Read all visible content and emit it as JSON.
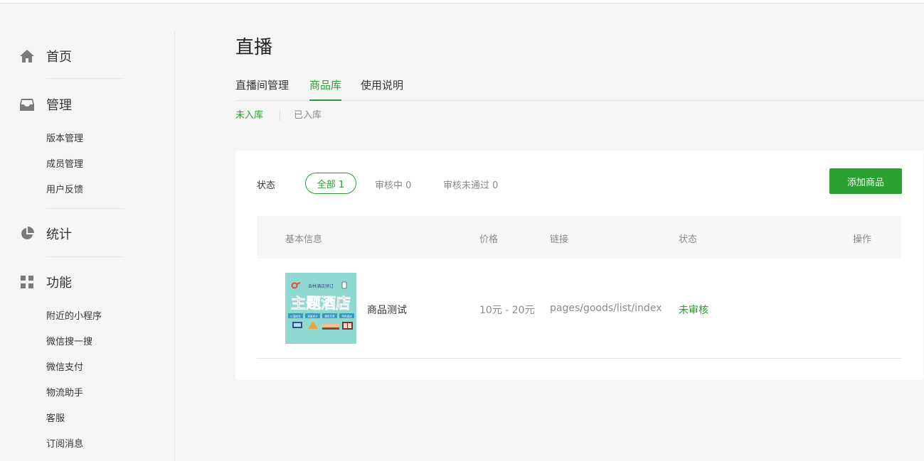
{
  "sidebar": {
    "home": {
      "label": "首页",
      "icon": "home-icon"
    },
    "manage": {
      "label": "管理",
      "icon": "inbox-icon",
      "items": [
        "版本管理",
        "成员管理",
        "用户反馈"
      ]
    },
    "stats": {
      "label": "统计",
      "icon": "pie-chart-icon"
    },
    "features": {
      "label": "功能",
      "icon": "grid-icon",
      "items": [
        "附近的小程序",
        "微信搜一搜",
        "微信支付",
        "物流助手",
        "客服",
        "订阅消息"
      ]
    }
  },
  "main": {
    "title": "直播",
    "tabs": [
      {
        "label": "直播间管理",
        "active": false
      },
      {
        "label": "商品库",
        "active": true
      },
      {
        "label": "使用说明",
        "active": false
      }
    ],
    "subtabs": [
      {
        "label": "未入库",
        "active": true
      },
      {
        "label": "已入库",
        "active": false
      }
    ],
    "filter": {
      "label": "状态",
      "options": [
        "全部 1",
        "审核中 0",
        "审核未通过 0"
      ],
      "selected": "全部 1"
    },
    "add_button": "添加商品",
    "table": {
      "headers": [
        "基本信息",
        "价格",
        "链接",
        "状态",
        "操作"
      ],
      "rows": [
        {
          "thumbnail": {
            "top_text": "去林酒店预订",
            "title": "主题酒店",
            "badges": [
              "IC酒店仓",
              "家庭亲子",
              "情侣专享",
              "特色酒店"
            ]
          },
          "name": "商品测试",
          "price": "10元 - 20元",
          "link": "pages/goods/list/index",
          "status": "未审核"
        }
      ]
    }
  },
  "colors": {
    "accent": "#29a030",
    "text": "#353535",
    "muted": "#8a8a8a",
    "thumb_bg": "#8fd9d1"
  }
}
